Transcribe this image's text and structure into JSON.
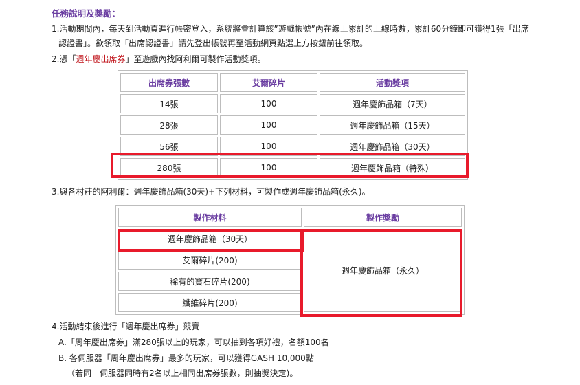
{
  "title": "任務說明及獎勵：",
  "item1": {
    "line1": "1.活動期間內，每天到活動頁進行帳密登入，系統將會計算該”遊戲帳號”內在線上累計的上線時數，累計60分鐘即可獲得1張「出席",
    "line2": "認證書」。欲領取「出席認證書」請先登出帳號再至活動網頁點選上方按鈕前往領取。"
  },
  "item2": {
    "prefix": "2.憑「",
    "highlight": "週年慶出席券",
    "suffix": "」至遊戲內找阿利爾可製作活動獎項。"
  },
  "table1": {
    "headers": [
      "出席券張數",
      "艾爾碎片",
      "活動獎項"
    ],
    "rows": [
      [
        "14張",
        "100",
        "週年慶飾品箱（7天）"
      ],
      [
        "28張",
        "100",
        "週年慶飾品箱（15天）"
      ],
      [
        "56張",
        "100",
        "週年慶飾品箱（30天）"
      ],
      [
        "280張",
        "100",
        "週年慶飾品箱（特殊）"
      ]
    ]
  },
  "item3": "3.與各村莊的阿利爾：週年慶飾品箱(30天)+下列材料，可製作成週年慶飾品箱(永久)。",
  "table2": {
    "headers": [
      "製作材料",
      "製作獎勵"
    ],
    "materials": [
      "週年慶飾品箱（30天）",
      "艾爾碎片(200)",
      "稀有的寶石碎片(200)",
      "纖維碎片(200)"
    ],
    "reward": "週年慶飾品箱（永久）"
  },
  "item4": {
    "line1": "4.活動結束後進行「週年慶出席券」競賽",
    "lineA": "A.「周年慶出席券」滿280張以上的玩家，可以抽到各項好禮，名額100名",
    "lineB": "B. 各伺服器「周年慶出席券」最多的玩家，可以獲得GASH 10,000點",
    "note": "（若同一伺服器同時有2名以上相同出席券張數，則抽獎決定)。"
  }
}
